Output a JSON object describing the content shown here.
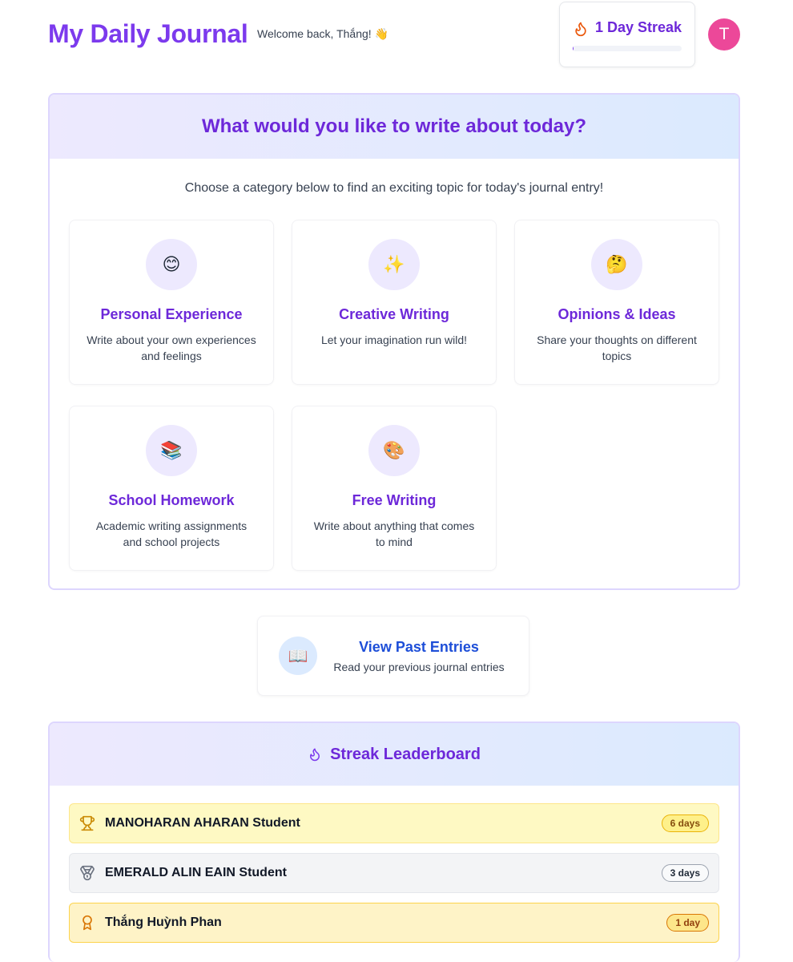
{
  "header": {
    "title": "My Daily Journal",
    "welcome": "Welcome back, Thắng! 👋",
    "streak_label": "1 Day Streak",
    "streak_progress": 0.01,
    "avatar_initial": "T"
  },
  "topics": {
    "heading": "What would you like to write about today?",
    "subheading": "Choose a category below to find an exciting topic for today's journal entry!",
    "cards": [
      {
        "emoji": "😊",
        "icon": "smile-icon",
        "title": "Personal Experience",
        "desc": "Write about your own experiences and feelings"
      },
      {
        "emoji": "✨",
        "icon": "sparkles-icon",
        "title": "Creative Writing",
        "desc": "Let your imagination run wild!"
      },
      {
        "emoji": "🤔",
        "icon": "thinking-icon",
        "title": "Opinions & Ideas",
        "desc": "Share your thoughts on different topics"
      },
      {
        "emoji": "📚",
        "icon": "books-icon",
        "title": "School Homework",
        "desc": "Academic writing assignments and school projects"
      },
      {
        "emoji": "🎨",
        "icon": "palette-icon",
        "title": "Free Writing",
        "desc": "Write about anything that comes to mind"
      }
    ]
  },
  "past_entries": {
    "emoji": "📖",
    "title": "View Past Entries",
    "subtitle": "Read your previous journal entries"
  },
  "leaderboard": {
    "title": "Streak Leaderboard",
    "rows": [
      {
        "icon": "trophy-icon",
        "name": "MANOHARAN AHARAN Student",
        "days": "6 days"
      },
      {
        "icon": "medal-icon",
        "name": "EMERALD ALIN EAIN Student",
        "days": "3 days"
      },
      {
        "icon": "award-icon",
        "name": "Thắng Huỳnh Phan",
        "days": "1 day"
      }
    ]
  },
  "colors": {
    "brand": "#7c3aed",
    "link": "#1d4ed8",
    "avatar": "#ec4899",
    "gold": "#ca8a04",
    "silver": "#6b7280",
    "bronze": "#d97706"
  }
}
